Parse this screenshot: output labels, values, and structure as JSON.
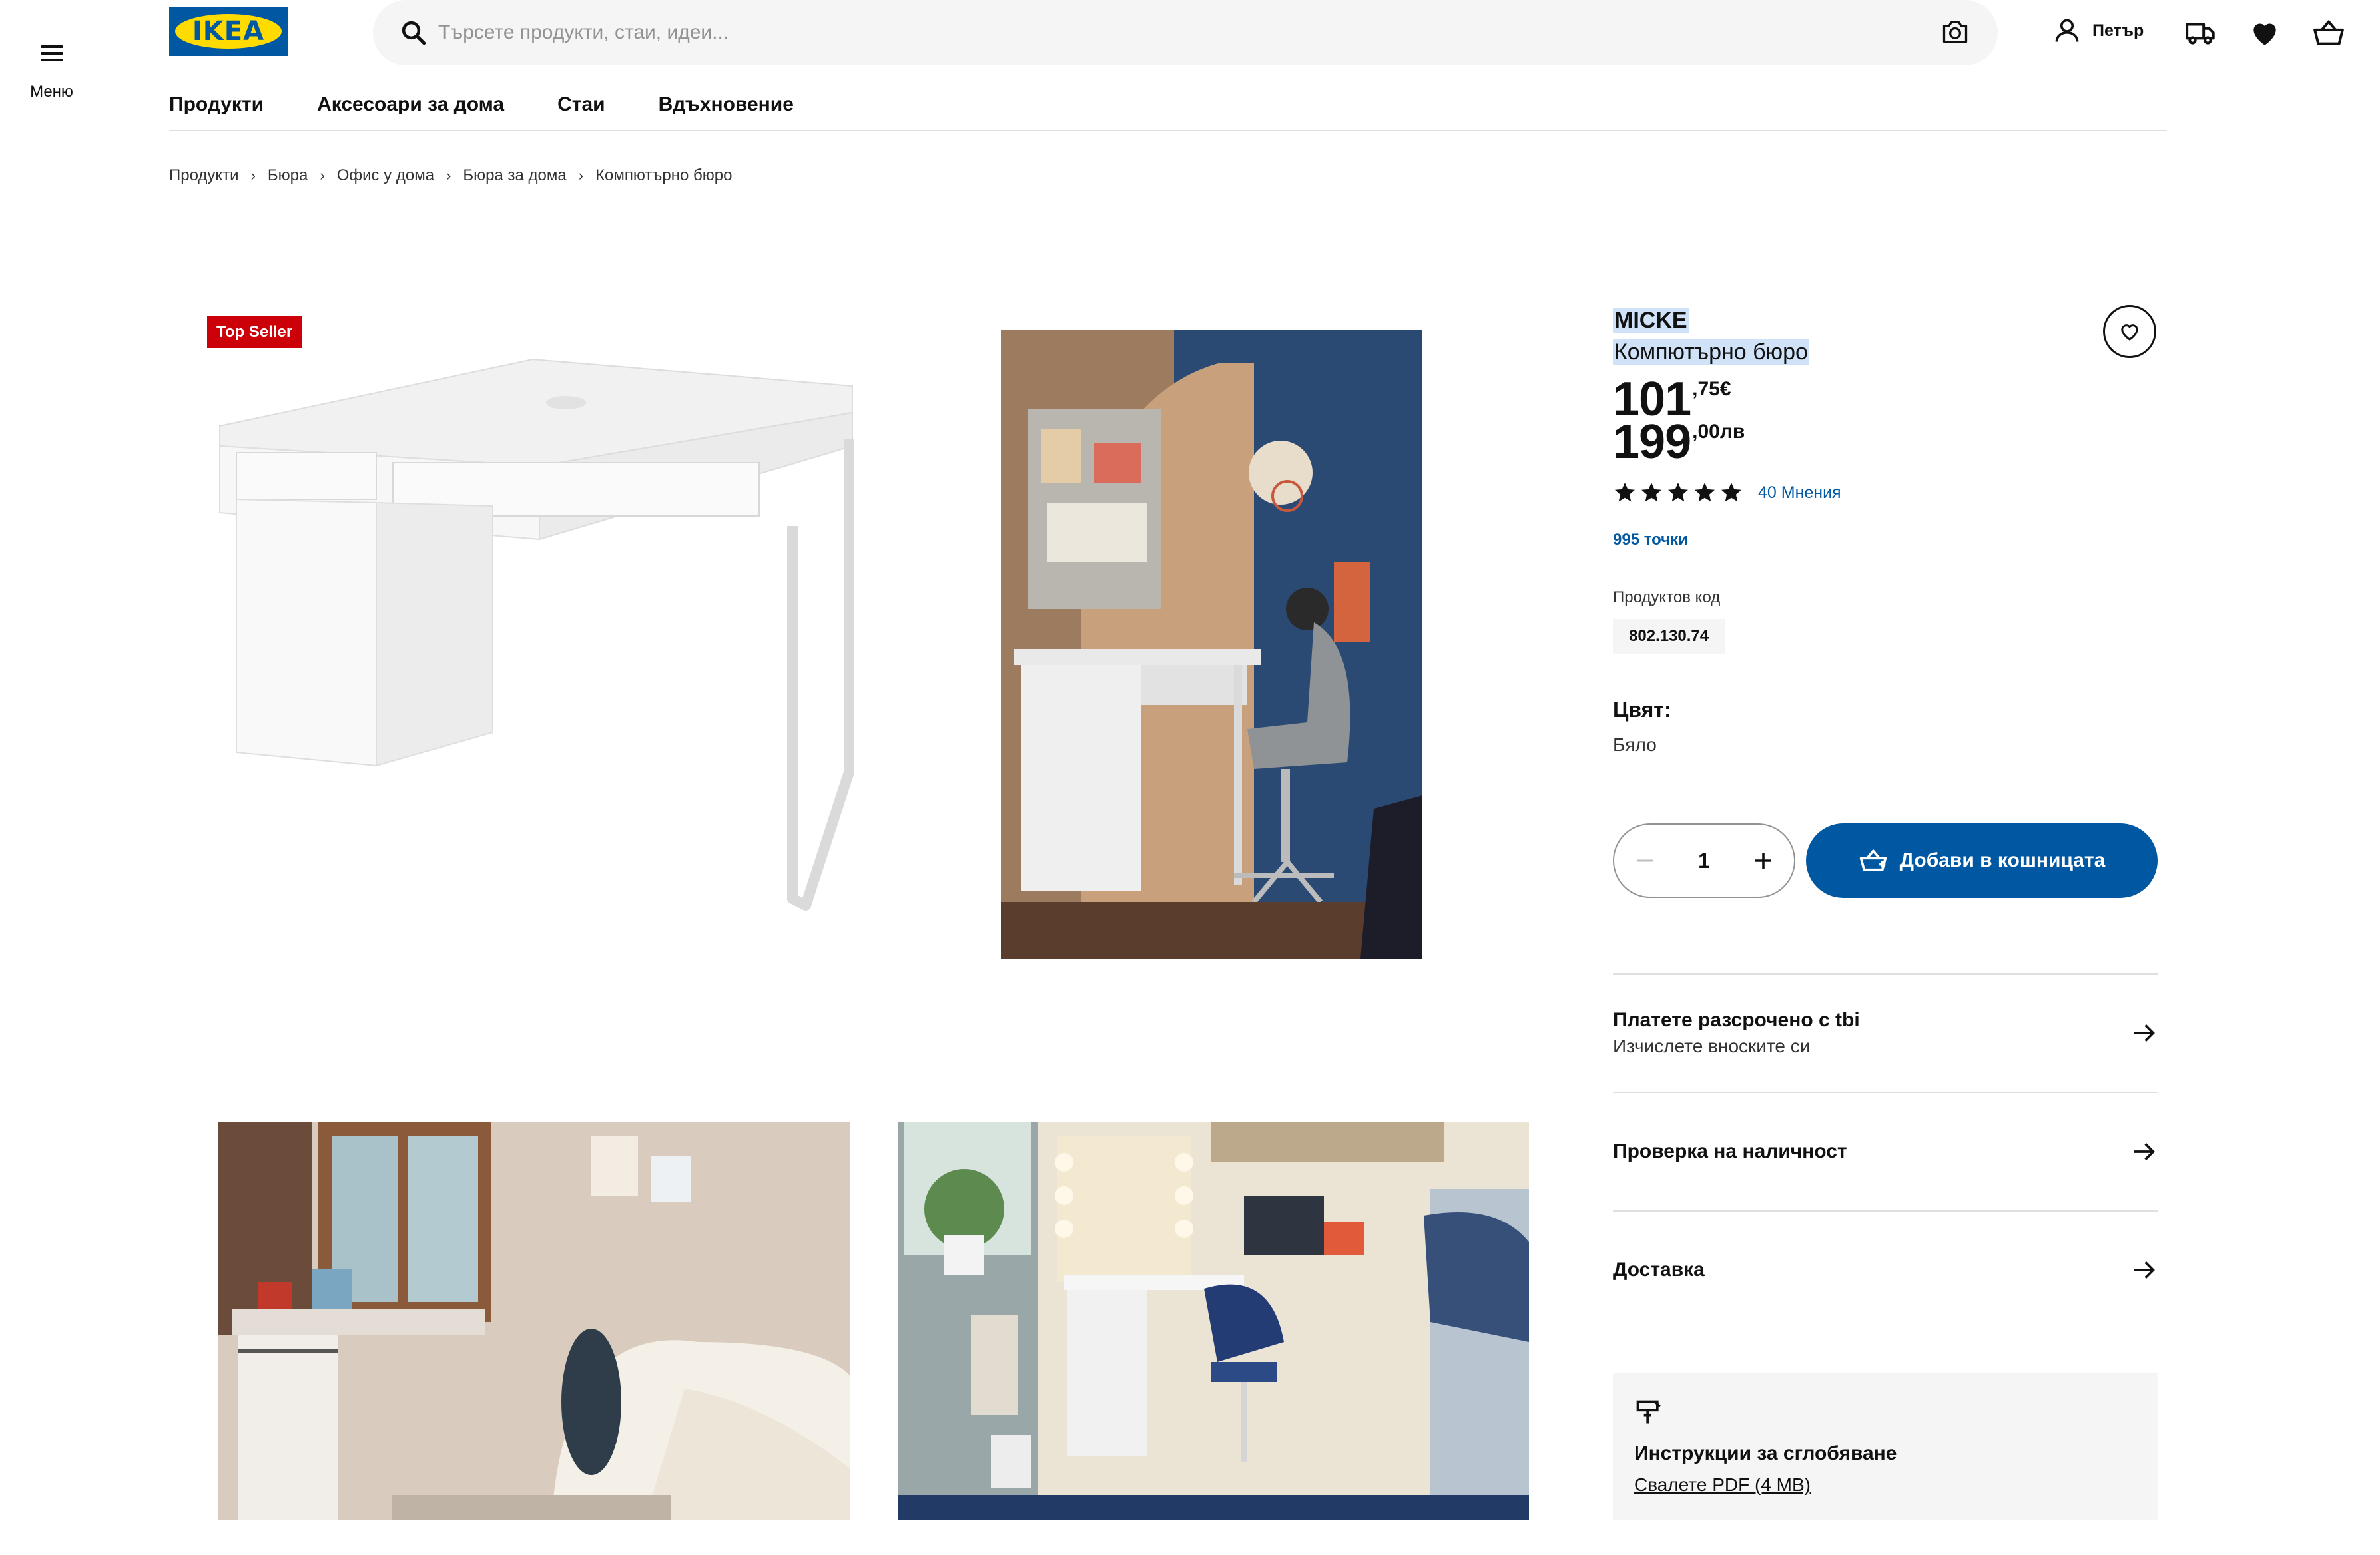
{
  "menu": {
    "label": "Меню"
  },
  "logo": {
    "text": "IKEA",
    "colors": {
      "blue": "#0058a3",
      "yellow": "#ffdb00"
    }
  },
  "search": {
    "placeholder": "Търсете продукти, стаи, идеи..."
  },
  "header": {
    "user_name": "Петър",
    "icons": [
      "user-icon",
      "delivery-truck-icon",
      "favorites-heart-icon",
      "shopping-basket-icon"
    ]
  },
  "nav": {
    "items": [
      "Продукти",
      "Аксесоари за дома",
      "Стаи",
      "Вдъхновение"
    ]
  },
  "breadcrumb": [
    "Продукти",
    "Бюра",
    "Офис у дома",
    "Бюра за дома",
    "Компютърно бюро"
  ],
  "gallery": {
    "badge": "Top Seller",
    "badge_color": "#cc0008"
  },
  "product": {
    "name": "MICKE",
    "description": "Компютърно бюро",
    "price_eur": {
      "whole": "101",
      "fraction": ",75€"
    },
    "price_bgn": {
      "whole": "199",
      "fraction": ",00лв"
    },
    "rating": 5,
    "reviews_label": "40 Мнения",
    "points": "995 точки",
    "code_label": "Продуктов код",
    "code": "802.130.74",
    "color_label": "Цвят:",
    "color_value": "Бяло"
  },
  "cart": {
    "quantity": "1",
    "add_label": "Добави в кошницата",
    "accent": "#0058a3"
  },
  "rows": [
    {
      "title": "Платете разсрочено с tbi",
      "subtitle": "Изчислете вноските си"
    },
    {
      "title": "Проверка на наличност",
      "subtitle": ""
    },
    {
      "title": "Доставка",
      "subtitle": ""
    }
  ],
  "assembly": {
    "title": "Инструкции за сглобяване",
    "link": "Свалете PDF (4 MB)"
  }
}
